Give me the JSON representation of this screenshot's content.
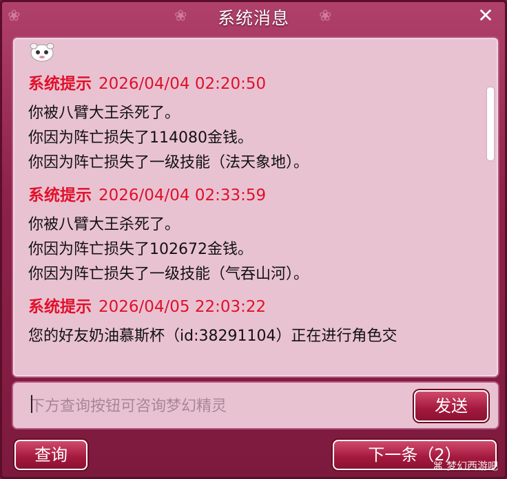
{
  "window": {
    "title": "系统消息",
    "close_label": "✕"
  },
  "messages": [
    {
      "label": "系统提示",
      "time": "2026/04/04 02:20:50",
      "lines": [
        "你被八臂大王杀死了。",
        "你因为阵亡损失了114080金钱。",
        "你因为阵亡损失了一级技能（法天象地）。"
      ]
    },
    {
      "label": "系统提示",
      "time": "2026/04/04 02:33:59",
      "lines": [
        "你被八臂大王杀死了。",
        "你因为阵亡损失了102672金钱。",
        "你因为阵亡损失了一级技能（气吞山河）。"
      ]
    },
    {
      "label": "系统提示",
      "time": "2026/04/05 22:03:22",
      "lines": [
        "您的好友奶油慕斯杯（id:38291104）正在进行角色交"
      ]
    }
  ],
  "input": {
    "placeholder": "下方查询按钮可咨询梦幻精灵"
  },
  "buttons": {
    "send": "发送",
    "query": "查询",
    "next": "下一条（2）"
  },
  "watermark": "梦幻西游吧",
  "colors": {
    "frame": "#8e2249",
    "panel": "#e9c2d2",
    "system_label": "#e0102a"
  }
}
